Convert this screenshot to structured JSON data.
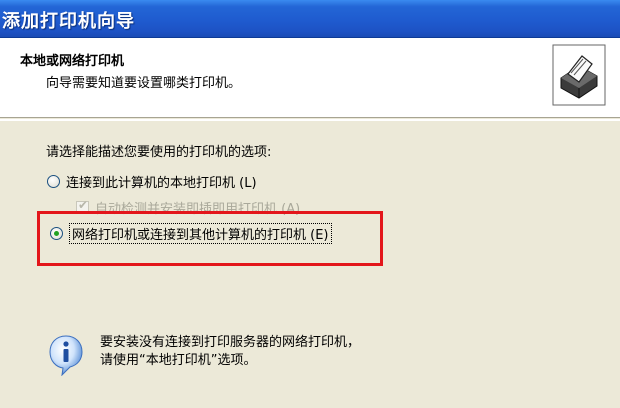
{
  "window": {
    "title": "添加打印机向导"
  },
  "header": {
    "title": "本地或网络打印机",
    "subtitle": "向导需要知道要设置哪类打印机。",
    "icon": "printer-icon"
  },
  "prompt": "请选择能描述您要使用的打印机的选项:",
  "options": [
    {
      "label": "连接到此计算机的本地打印机 (L)",
      "checked": false,
      "enabled": true
    },
    {
      "label": "网络打印机或连接到其他计算机的打印机 (E)",
      "checked": true,
      "enabled": true
    }
  ],
  "auto_detect": {
    "label": "自动检测并安装即插即用打印机 (A)",
    "checked": true,
    "enabled": false
  },
  "info": {
    "icon": "info-icon",
    "line1": "要安装没有连接到打印服务器的网络打印机，",
    "line2": "请使用“本地打印机”选项。"
  },
  "colors": {
    "titlebar": "#1f5bcf",
    "highlight": "#e3161b",
    "background": "#ece9d8"
  }
}
